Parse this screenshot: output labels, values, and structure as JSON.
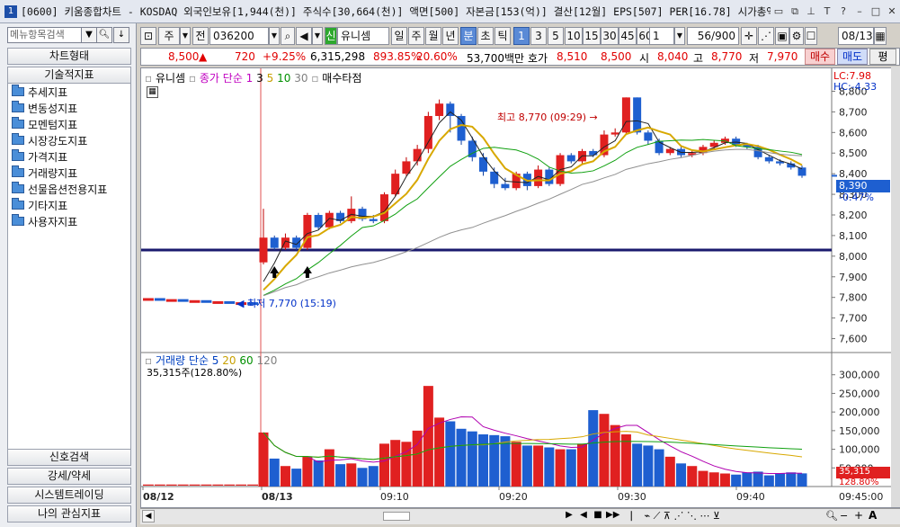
{
  "window": {
    "badge": "1",
    "title": "[0600] 키움종합차트 - KOSDAQ 외국인보유[1,944(천)] 주식수[30,664(천)] 액면[500] 자본금[153(억)] 결산[12월] EPS[507] PER[16.78] 시가총액[",
    "icons": [
      "restore-icon",
      "copy-window-icon",
      "pin-icon",
      "text-size-icon",
      "help-icon",
      "minimize-icon",
      "maximize-icon",
      "close-icon"
    ]
  },
  "left_panel": {
    "search_placeholder": "메뉴항목검색",
    "chart_type_btn": "차트형태",
    "tech_indicator_btn": "기술적지표",
    "folders": [
      "추세지표",
      "변동성지표",
      "모멘텀지표",
      "시장강도지표",
      "가격지표",
      "거래량지표",
      "선물옵션전용지표",
      "기타지표",
      "사용자지표"
    ],
    "bottom_buttons": [
      "신호검색",
      "강세/약세",
      "시스템트레이딩",
      "나의 관심지표"
    ]
  },
  "toolbar": {
    "period_main": "주",
    "jeon": "전",
    "code": "036200",
    "sin": "신",
    "name": "유니셈",
    "periods": [
      "일",
      "주",
      "월",
      "년",
      "분",
      "초",
      "틱"
    ],
    "selected_period": "분",
    "intervals": [
      "1",
      "3",
      "5",
      "10",
      "15",
      "30",
      "45",
      "60"
    ],
    "selected_interval": "1",
    "interval_value": "1",
    "count": "56/900",
    "date": "08/13"
  },
  "quote": {
    "price": "8,500",
    "change": "720",
    "change_pct": "+9.25%",
    "volume": "6,315,298",
    "vol_ratio": "893.85%",
    "rate": "20.60%",
    "amount": "53,700백만",
    "hoga_label": "호가",
    "ask": "8,510",
    "bid": "8,500",
    "open_label": "시",
    "open": "8,040",
    "high_label": "고",
    "high": "8,770",
    "low_label": "저",
    "low": "7,970",
    "buy": "매수",
    "sell": "매도",
    "eval": "평"
  },
  "price_chart": {
    "legend_name": "유니셈",
    "legend_ma": "종가 단순 1",
    "ma_periods": [
      "3",
      "5",
      "10",
      "30"
    ],
    "legend_signal": "매수타점",
    "lc": "LC:7.98",
    "hc": "HC:-4.33",
    "high_annot": "최고 8,770 (09:29)",
    "low_annot": "최저 7,770 (15:19)",
    "current_price": "8,390",
    "current_pct": "-0.47%",
    "y_ticks": [
      "8,800",
      "8,700",
      "8,600",
      "8,500",
      "8,400",
      "8,300",
      "8,200",
      "8,100",
      "8,000",
      "7,900",
      "7,800",
      "7,700",
      "7,600"
    ]
  },
  "volume_chart": {
    "legend_name": "거래량 단순 5",
    "legend_periods": [
      "20",
      "60",
      "120"
    ],
    "current_vol": "35,315주(128.80%)",
    "tag_vol": "35,315",
    "tag_pct": "128.80%",
    "y_ticks": [
      "300,000",
      "250,000",
      "200,000",
      "150,000",
      "100,000",
      "50,000"
    ]
  },
  "time_axis": [
    "08/12",
    "08/13",
    "09:10",
    "09:20",
    "09:30",
    "09:40",
    "09:45:00"
  ],
  "chart_data": {
    "type": "candlestick",
    "title": "",
    "x_axis_labels": [
      "08/12",
      "08/13",
      "09:10",
      "09:20",
      "09:30",
      "09:40",
      "09:45:00"
    ],
    "price_ylim": [
      7550,
      8850
    ],
    "volume_ylim": [
      0,
      350000
    ],
    "reference_line": 8030,
    "signal_arrows": [
      1,
      4
    ],
    "candles_prev_day": [
      7790,
      7790,
      7785,
      7785,
      7780,
      7780,
      7775,
      7775,
      7770,
      7770
    ],
    "candles": [
      [
        7970,
        8090,
        8230,
        7960
      ],
      [
        8090,
        8040,
        8100,
        8030
      ],
      [
        8040,
        8090,
        8110,
        8030
      ],
      [
        8090,
        8040,
        8100,
        8030
      ],
      [
        8040,
        8200,
        8210,
        8030
      ],
      [
        8200,
        8140,
        8210,
        8130
      ],
      [
        8140,
        8210,
        8220,
        8130
      ],
      [
        8210,
        8170,
        8220,
        8160
      ],
      [
        8170,
        8230,
        8290,
        8160
      ],
      [
        8230,
        8180,
        8240,
        8170
      ],
      [
        8180,
        8170,
        8200,
        8160
      ],
      [
        8170,
        8300,
        8310,
        8160
      ],
      [
        8300,
        8400,
        8420,
        8290
      ],
      [
        8400,
        8460,
        8480,
        8390
      ],
      [
        8460,
        8520,
        8540,
        8440
      ],
      [
        8520,
        8680,
        8700,
        8500
      ],
      [
        8680,
        8740,
        8760,
        8660
      ],
      [
        8740,
        8680,
        8750,
        8600
      ],
      [
        8680,
        8560,
        8690,
        8540
      ],
      [
        8560,
        8480,
        8580,
        8460
      ],
      [
        8480,
        8410,
        8500,
        8390
      ],
      [
        8410,
        8350,
        8430,
        8330
      ],
      [
        8350,
        8330,
        8380,
        8320
      ],
      [
        8330,
        8400,
        8410,
        8320
      ],
      [
        8400,
        8340,
        8410,
        8320
      ],
      [
        8340,
        8420,
        8440,
        8330
      ],
      [
        8420,
        8350,
        8430,
        8340
      ],
      [
        8350,
        8490,
        8500,
        8340
      ],
      [
        8490,
        8460,
        8500,
        8450
      ],
      [
        8460,
        8510,
        8520,
        8450
      ],
      [
        8510,
        8490,
        8520,
        8480
      ],
      [
        8490,
        8590,
        8610,
        8480
      ],
      [
        8590,
        8600,
        8620,
        8580
      ],
      [
        8600,
        8770,
        8770,
        8590
      ],
      [
        8770,
        8600,
        8770,
        8590
      ],
      [
        8600,
        8560,
        8610,
        8540
      ],
      [
        8560,
        8500,
        8570,
        8490
      ],
      [
        8500,
        8520,
        8530,
        8490
      ],
      [
        8520,
        8490,
        8530,
        8480
      ],
      [
        8490,
        8500,
        8510,
        8480
      ],
      [
        8500,
        8530,
        8540,
        8490
      ],
      [
        8530,
        8550,
        8560,
        8520
      ],
      [
        8550,
        8570,
        8580,
        8540
      ],
      [
        8570,
        8540,
        8580,
        8530
      ],
      [
        8540,
        8530,
        8550,
        8520
      ],
      [
        8530,
        8480,
        8540,
        8470
      ],
      [
        8480,
        8460,
        8490,
        8450
      ],
      [
        8460,
        8450,
        8470,
        8440
      ],
      [
        8450,
        8430,
        8460,
        8420
      ],
      [
        8430,
        8390,
        8440,
        8380
      ]
    ],
    "volumes_prev_day": [
      3000,
      3000,
      3000,
      3000,
      3000,
      3000,
      3000,
      3000,
      3000,
      3000
    ],
    "volumes": [
      145000,
      75000,
      55000,
      48000,
      80000,
      70000,
      100000,
      60000,
      62000,
      50000,
      55000,
      115000,
      125000,
      120000,
      150000,
      270000,
      185000,
      175000,
      155000,
      148000,
      140000,
      138000,
      135000,
      120000,
      110000,
      110000,
      105000,
      100000,
      100000,
      115000,
      205000,
      195000,
      165000,
      140000,
      115000,
      110000,
      100000,
      80000,
      62000,
      55000,
      42000,
      38000,
      35000,
      32000,
      38000,
      40000,
      30000,
      35000,
      38000,
      35315
    ]
  }
}
